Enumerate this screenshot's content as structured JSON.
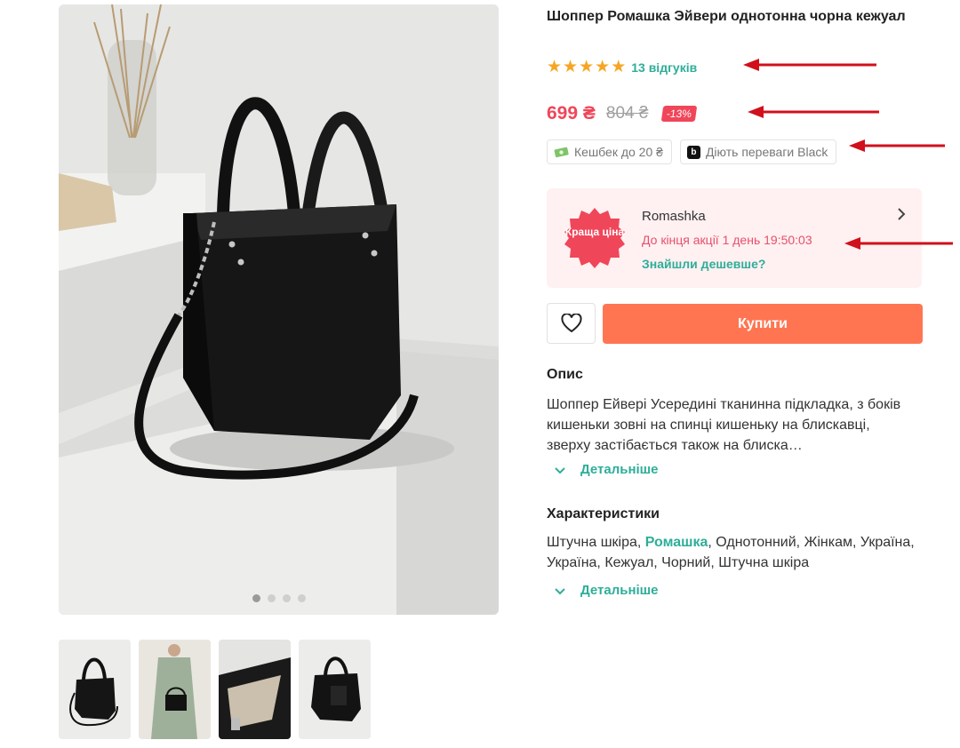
{
  "product": {
    "title": "Шоппер Ромашка Эйвери однотонна чорна кежуал",
    "rating_stars": 5,
    "reviews": "13 відгуків"
  },
  "price": {
    "current": "699 ₴",
    "old": "804 ₴",
    "discount": "-13%"
  },
  "perks": [
    {
      "label": "Кешбек до 20 ₴",
      "icon": "cashback-money-icon"
    },
    {
      "label": "Діють переваги Black",
      "icon": "black-b-icon"
    }
  ],
  "promo": {
    "badge": "Краща ціна",
    "seller": "Romashka",
    "countdown": "До кінця акції 1 день 19:50:03",
    "cheaper_link": "Знайшли дешевше?"
  },
  "actions": {
    "buy": "Купити"
  },
  "description": {
    "heading": "Опис",
    "text": "Шоппер Ейвері Усередині тканинна підкладка, з боків кишеньки зовні на спинці кишеньку на блискавці, зверху застібається також на блиска…",
    "more": "Детальніше"
  },
  "characteristics": {
    "heading": "Характеристики",
    "before": "Штучна шкіра, ",
    "brand": "Ромашка",
    "after": ", Однотонний, Жінкам, Україна, Україна, Кежуал, Чорний, Штучна шкіра",
    "more": "Детальніше"
  },
  "gallery": {
    "slides": 4,
    "active_slide": 1,
    "thumbnails": 4
  },
  "colors": {
    "accent_teal": "#2eae98",
    "price_red": "#f0465a",
    "buy_orange": "#ff7552",
    "star_gold": "#f5a623",
    "promo_bg": "#fff0f1",
    "annotation_red": "#d0101b"
  }
}
